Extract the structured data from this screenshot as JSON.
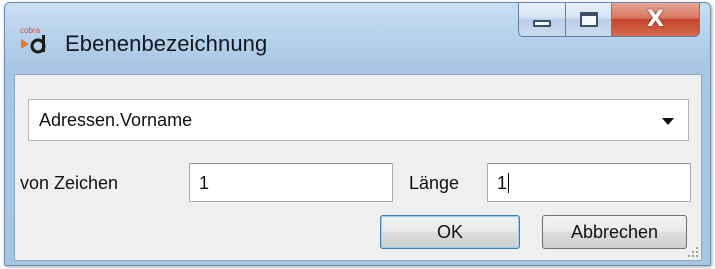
{
  "window": {
    "title": "Ebenenbezeichnung",
    "app_icon": "cobra-d-icon",
    "app_icon_text": "cobra",
    "close_glyph": "X"
  },
  "field": {
    "selected": "Adressen.Vorname"
  },
  "range": {
    "from_label": "von Zeichen",
    "from_value": "1",
    "length_label": "Länge",
    "length_value": "1"
  },
  "buttons": {
    "ok": "OK",
    "cancel": "Abbrechen"
  },
  "colors": {
    "close_button": "#c5452a",
    "titlebar": "#b9d3ec",
    "client": "#f0f0f0"
  }
}
